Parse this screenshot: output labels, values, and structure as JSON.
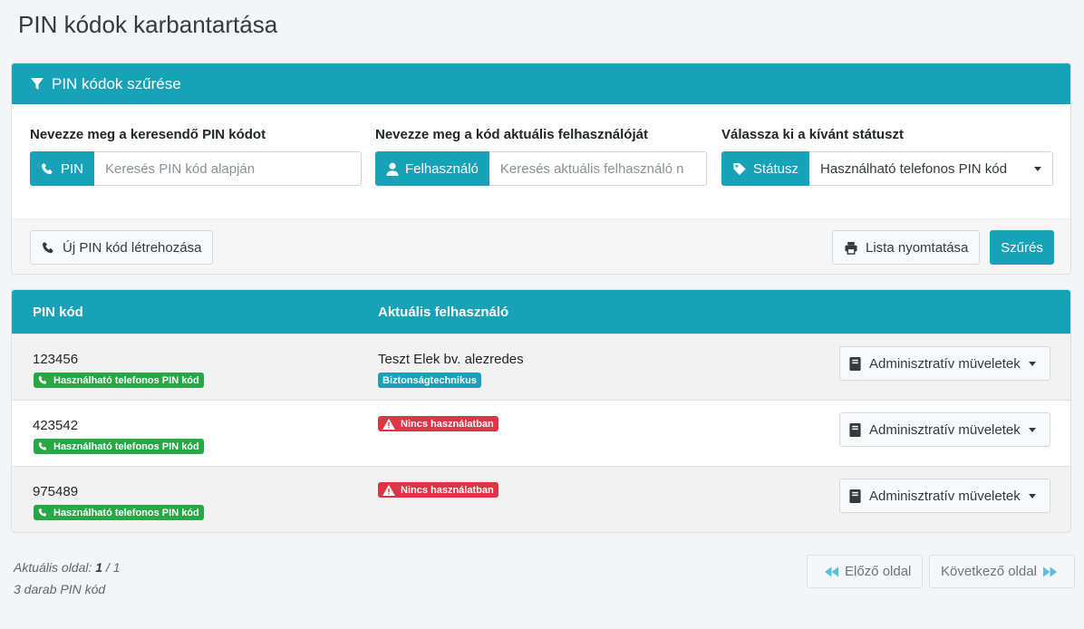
{
  "page": {
    "title": "PIN kódok karbantartása"
  },
  "filter": {
    "header": "PIN kódok szűrése",
    "pin": {
      "label": "Nevezze meg a keresendő PIN kódot",
      "addon": "PIN",
      "placeholder": "Keresés PIN kód alapján"
    },
    "user": {
      "label": "Nevezze meg a kód aktuális felhasználóját",
      "addon": "Felhasználó",
      "placeholder": "Keresés aktuális felhasználó n"
    },
    "status": {
      "label": "Válassza ki a kívánt státuszt",
      "addon": "Státusz",
      "selected": "Használható telefonos PIN kód"
    },
    "new_button": "Új PIN kód létrehozása",
    "print_button": "Lista nyomtatása",
    "filter_button": "Szűrés"
  },
  "table": {
    "headers": [
      "PIN kód",
      "Aktuális felhasználó"
    ],
    "rows": [
      {
        "pin": "123456",
        "status": "Használható telefonos PIN kód",
        "user": "Teszt Elek bv. alezredes",
        "role": "Biztonságtechnikus",
        "action": "Adminisztratív müveletek"
      },
      {
        "pin": "423542",
        "status": "Használható telefonos PIN kód",
        "user_status": "Nincs használatban",
        "action": "Adminisztratív müveletek"
      },
      {
        "pin": "975489",
        "status": "Használható telefonos PIN kód",
        "user_status": "Nincs használatban",
        "action": "Adminisztratív müveletek"
      }
    ]
  },
  "pagination": {
    "label": "Aktuális oldal:",
    "current": "1",
    "total": "/ 1",
    "count_text": "3  darab PIN kód",
    "prev": "Előző oldal",
    "next": "Következő oldal"
  },
  "colors": {
    "accent": "#17a2b8",
    "success": "#28a745",
    "danger": "#dc3545"
  }
}
